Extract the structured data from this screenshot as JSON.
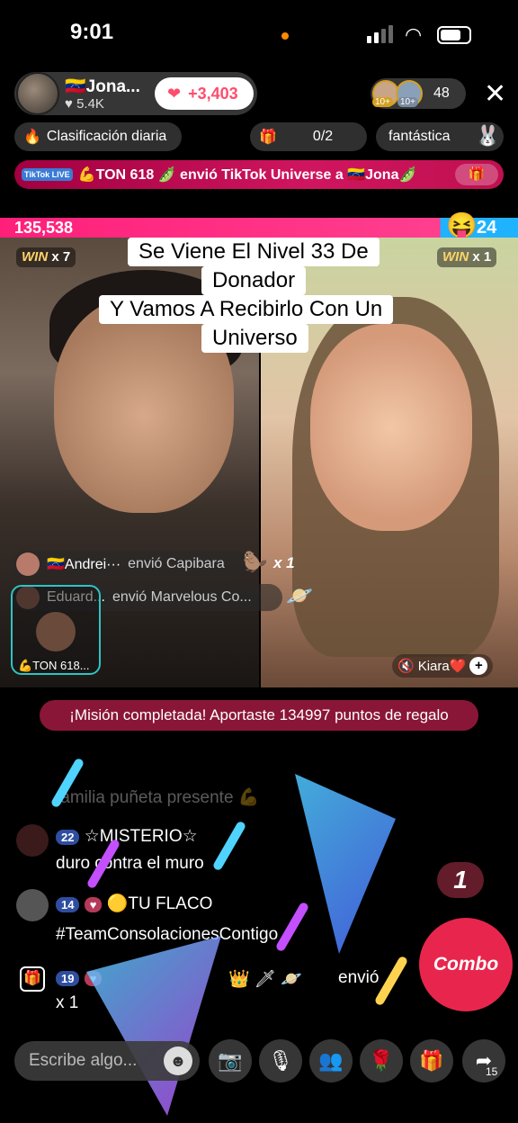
{
  "status": {
    "time": "9:01"
  },
  "host": {
    "name": "Jona...",
    "flag": "🇻🇪",
    "likes": "♥ 5.4K",
    "like_delta": "+3,403"
  },
  "viewers": {
    "count": "48",
    "badge1": "10+",
    "badge2": "10+"
  },
  "pills": {
    "rank_label": "Clasificación diaria",
    "mission_value": "0/2",
    "fan_label": "fantástica"
  },
  "banner": {
    "tag": "TikTok LIVE",
    "text": "💪TON 618 🫛 envió TikTok Universe a 🇻🇪Jona🫛"
  },
  "battle": {
    "score_left": "135,538",
    "score_right": "24",
    "win_left": "x 7",
    "win_right": "x 1",
    "win_word": "WIN"
  },
  "caption": {
    "line1": "Se Viene El Nivel 33 De",
    "line2": "Donador",
    "line3": "Y Vamos A Recibirlo Con Un",
    "line4": "Universo"
  },
  "gifts": [
    {
      "user": "🇻🇪Andrei···",
      "action": "envió Capibara",
      "count": "x 1"
    },
    {
      "user": "Eduard...",
      "action": "envió Marvelous Co..."
    }
  ],
  "gift_card_label": "💪TON 618...",
  "kiara_tag": "Kiara❤️",
  "mission_banner": "¡Misión completada! Aportaste 134997 puntos de regalo",
  "chat": {
    "faded": "familia puñeta presente 💪",
    "msg1_level": "22",
    "msg1_user": "☆MISTERIO☆",
    "msg1_text": "duro contra el muro",
    "msg2_level": "14",
    "msg2_user": "🟡TU FLACO",
    "msg2_text": "#TeamConsolacionesContigo",
    "msg3_level": "19",
    "msg3_action": "envió",
    "msg3_count": "x 1"
  },
  "combo": {
    "label": "Combo",
    "count": "1"
  },
  "bottom": {
    "placeholder": "Escribe algo...",
    "share_count": "15"
  },
  "colors": {
    "battle_pink": "#ff1f7a",
    "battle_blue": "#1fb2ff",
    "combo_red": "#e8264d",
    "banner_red": "#c01050"
  }
}
